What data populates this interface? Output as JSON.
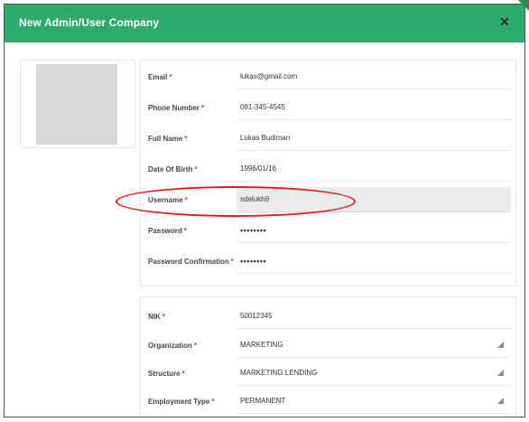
{
  "header": {
    "title": "New Admin/User Company",
    "close_icon": "✕"
  },
  "colors": {
    "header_bg": "#2eaa6a",
    "required": "#e53935",
    "annotation": "#e01b1b"
  },
  "account_form": {
    "fields": [
      {
        "label": "Email",
        "required": "*",
        "value": "lukas@gmail.com"
      },
      {
        "label": "Phone Number",
        "required": "*",
        "value": "081-345-4545"
      },
      {
        "label": "Full Name",
        "required": "*",
        "value": "Lukas Budiman"
      },
      {
        "label": "Date Of Birth",
        "required": "*",
        "value": "1996/01/16"
      },
      {
        "label": "Username",
        "required": "*",
        "value": "sdelukh9"
      },
      {
        "label": "Password",
        "required": "*",
        "value": "••••••••"
      },
      {
        "label": "Password Confirmation",
        "required": "*",
        "value": "••••••••"
      }
    ]
  },
  "employment_form": {
    "fields": [
      {
        "label": "NIK",
        "required": "*",
        "value": "50012345"
      },
      {
        "label": "Organization",
        "required": "*",
        "value": "MARKETING"
      },
      {
        "label": "Structure",
        "required": "*",
        "value": "MARKETING LENDING"
      },
      {
        "label": "Employment Type",
        "required": "*",
        "value": "PERMANENT"
      }
    ]
  }
}
